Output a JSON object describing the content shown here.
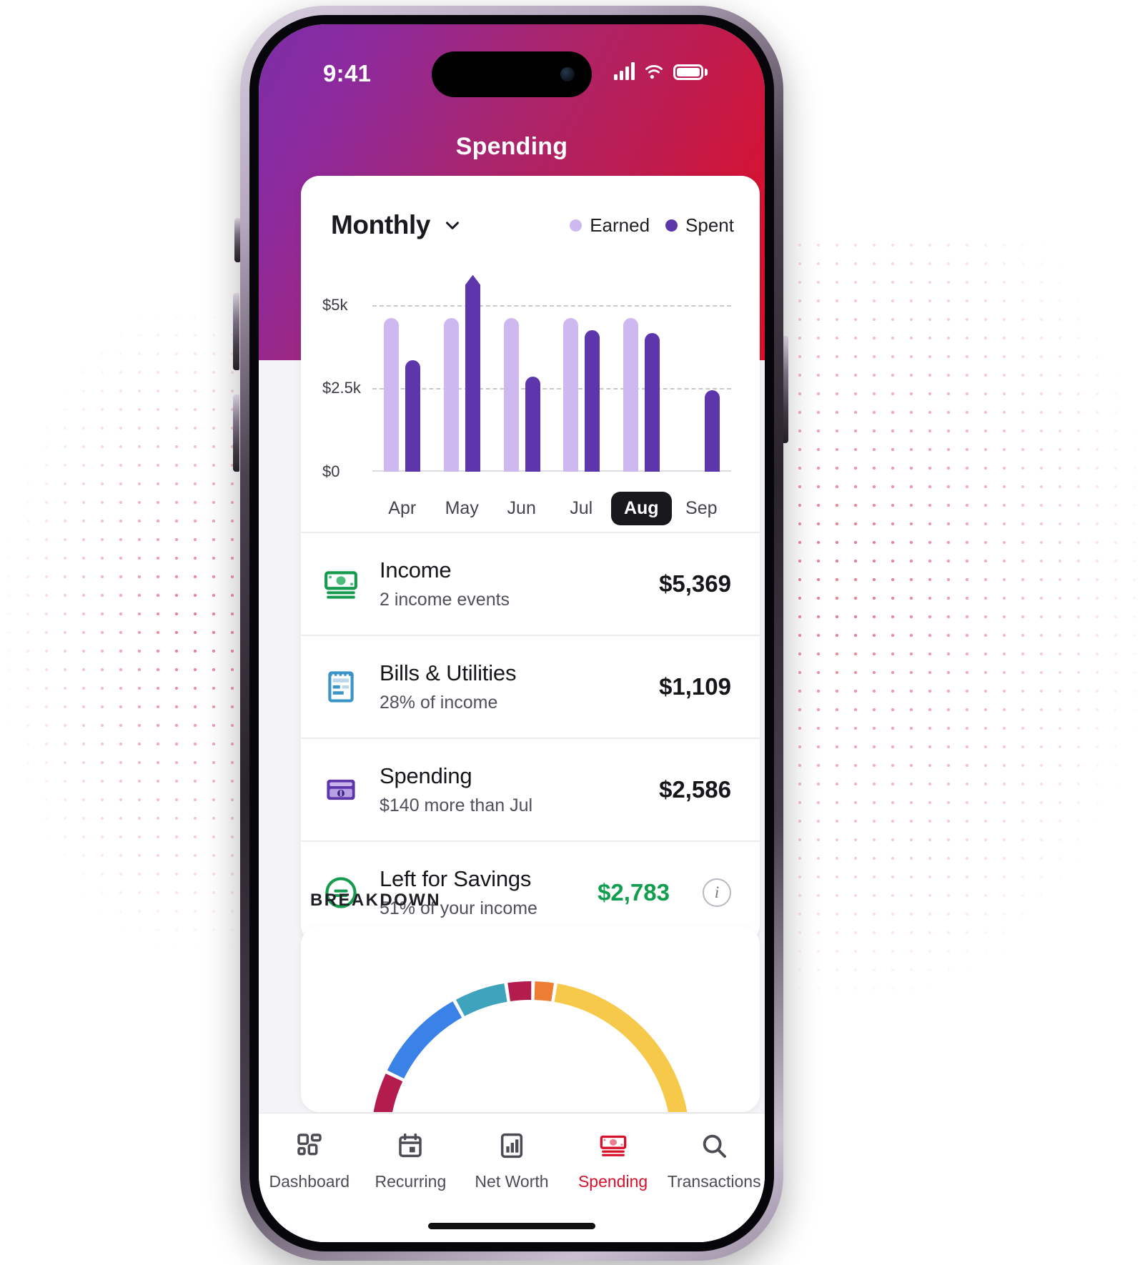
{
  "status_bar": {
    "time": "9:41",
    "cellular_icon": "signal-bars-icon",
    "wifi_icon": "wifi-icon",
    "battery_icon": "battery-full-icon"
  },
  "header": {
    "title": "Spending"
  },
  "chart_card": {
    "period_label": "Monthly",
    "period_chevron_icon": "chevron-down-icon",
    "legend": [
      {
        "label": "Earned",
        "color": "#cdb9ef"
      },
      {
        "label": "Spent",
        "color": "#5e36ab"
      }
    ]
  },
  "chart_data": {
    "type": "bar",
    "title": "Monthly Earned vs Spent",
    "xlabel": "",
    "ylabel": "",
    "categories": [
      "Apr",
      "May",
      "Jun",
      "Jul",
      "Aug",
      "Sep"
    ],
    "ytick_labels": [
      "$5k",
      "$2.5k",
      "$0"
    ],
    "ytick_values": [
      5000,
      2500,
      0
    ],
    "ylim": [
      0,
      6000
    ],
    "grid": true,
    "legend_position": "top-right",
    "selected_category": "Aug",
    "series": [
      {
        "name": "Earned",
        "color": "#cdb9ef",
        "values": [
          4600,
          4600,
          4600,
          4600,
          4600,
          null
        ]
      },
      {
        "name": "Spent",
        "color": "#5e36ab",
        "values": [
          3350,
          5900,
          2850,
          4250,
          4150,
          2450
        ]
      }
    ]
  },
  "summary_rows": [
    {
      "icon": "money-bills-icon",
      "title": "Income",
      "subtitle": "2 income events",
      "amount": "$5,369",
      "amount_color": "#17171b"
    },
    {
      "icon": "receipt-icon",
      "title": "Bills & Utilities",
      "subtitle": "28% of income",
      "amount": "$1,109",
      "amount_color": "#17171b"
    },
    {
      "icon": "credit-card-icon",
      "title": "Spending",
      "subtitle": "$140 more than Jul",
      "amount": "$2,586",
      "amount_color": "#17171b"
    },
    {
      "icon": "savings-circle-icon",
      "title": "Left for Savings",
      "subtitle": "51% of your income",
      "amount": "$2,783",
      "amount_color": "#119e4e",
      "info_icon": "info-icon",
      "info_glyph": "i"
    }
  ],
  "breakdown": {
    "section_label": "BREAKDOWN",
    "arc_segments": [
      {
        "color": "#b51c4e",
        "span": 16
      },
      {
        "color": "#3b82e8",
        "span": 22
      },
      {
        "color": "#3fa3bd",
        "span": 12
      },
      {
        "color": "#b51c4e",
        "span": 6
      },
      {
        "color": "#ec7d33",
        "span": 5
      },
      {
        "color": "#f6c košt",
        "span": 0
      },
      {
        "color": "#f7c94b",
        "span": 49
      }
    ]
  },
  "bottom_nav": {
    "items": [
      {
        "label": "Dashboard",
        "icon": "dashboard-grid-icon",
        "active": false
      },
      {
        "label": "Recurring",
        "icon": "calendar-icon",
        "active": false
      },
      {
        "label": "Net Worth",
        "icon": "bar-chart-icon",
        "active": false
      },
      {
        "label": "Spending",
        "icon": "money-bills-icon",
        "active": true
      },
      {
        "label": "Transactions",
        "icon": "search-icon",
        "active": false
      }
    ],
    "active_color": "#d6112c",
    "inactive_color": "#4c4c55"
  }
}
